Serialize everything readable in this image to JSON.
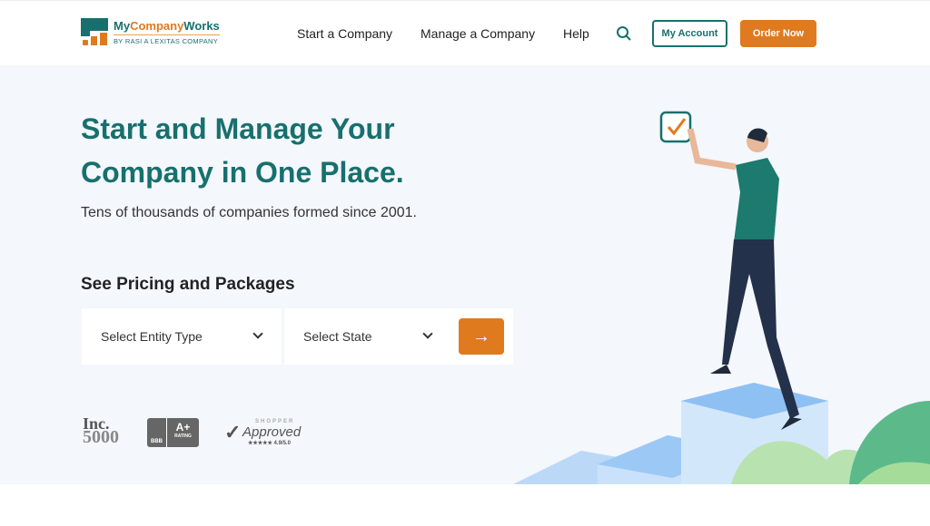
{
  "header": {
    "brand_a": "My",
    "brand_b": "Company",
    "brand_c": "Works",
    "brand_sub": "BY RASI A LEXITAS COMPANY",
    "nav": [
      "Start a Company",
      "Manage a Company",
      "Help"
    ],
    "search_icon": "search-icon",
    "account": "My Account",
    "order": "Order Now"
  },
  "hero": {
    "title": "Start and Manage Your Company in One Place.",
    "tagline": "Tens of thousands of companies formed since 2001.",
    "pricing_heading": "See Pricing and Packages",
    "entity_select": "Select Entity Type",
    "state_select": "Select State",
    "go_icon": "arrow-right-icon"
  },
  "badges": {
    "inc": "Inc.",
    "inc_num": "5000",
    "bbb": "BBB",
    "bbb_grade": "A+",
    "bbb_rating": "RATING",
    "shopper": "SHOPPER",
    "approved": "Approved",
    "score": "★★★★★ 4.9/5.0"
  },
  "colors": {
    "primary": "#17706e",
    "accent": "#e07a1f",
    "background": "#f4f7fc"
  }
}
